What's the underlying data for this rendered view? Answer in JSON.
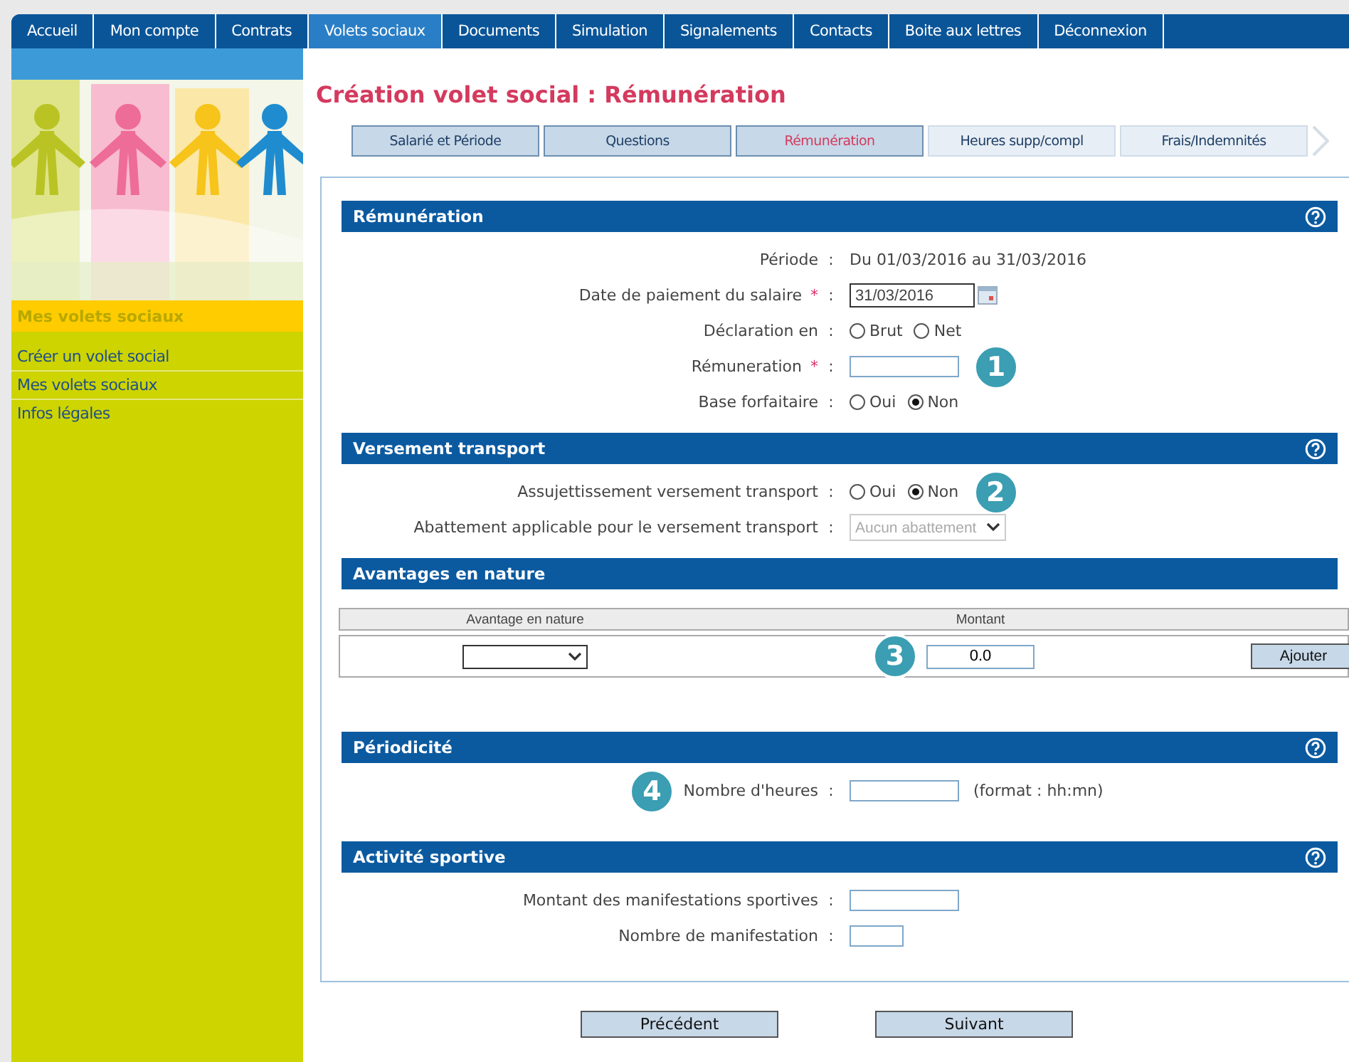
{
  "nav": [
    {
      "label": "Accueil",
      "selected": false
    },
    {
      "label": "Mon compte",
      "selected": false
    },
    {
      "label": "Contrats",
      "selected": false
    },
    {
      "label": "Volets sociaux",
      "selected": true
    },
    {
      "label": "Documents",
      "selected": false
    },
    {
      "label": "Simulation",
      "selected": false
    },
    {
      "label": "Signalements",
      "selected": false
    },
    {
      "label": "Contacts",
      "selected": false
    },
    {
      "label": "Boite aux lettres",
      "selected": false
    },
    {
      "label": "Déconnexion",
      "selected": false
    }
  ],
  "sidebar": {
    "heading": "Mes volets sociaux",
    "items": [
      "Créer un volet social",
      "Mes volets sociaux",
      "Infos légales"
    ]
  },
  "title": "Création volet social : Rémunération",
  "steps": [
    {
      "label": "Salarié et Période",
      "selected": false,
      "available": true
    },
    {
      "label": "Questions",
      "selected": false,
      "available": true
    },
    {
      "label": "Rémunération",
      "selected": true,
      "available": true
    },
    {
      "label": "Heures supp/compl",
      "selected": false,
      "available": false
    },
    {
      "label": "Frais/Indemnités",
      "selected": false,
      "available": false
    }
  ],
  "sections": [
    {
      "title": "Rémunération",
      "help": true,
      "kind": "form",
      "rows": [
        {
          "label": "Période",
          "separator": ":",
          "kind": "text",
          "value": "Du 01/03/2016 au 31/03/2016"
        },
        {
          "label": "Date de paiement du salaire",
          "marker": "*",
          "separator": ":",
          "kind": "date",
          "value": "31/03/2016"
        },
        {
          "label": "Déclaration en",
          "separator": ":",
          "kind": "radio",
          "options": [
            {
              "label": "Brut",
              "selected": false
            },
            {
              "label": "Net",
              "selected": false
            }
          ]
        },
        {
          "label": "Rémuneration",
          "marker": "*",
          "separator": ":",
          "kind": "input",
          "callout": "1"
        },
        {
          "label": "Base forfaitaire",
          "separator": ":",
          "kind": "radio",
          "options": [
            {
              "label": "Oui",
              "selected": false
            },
            {
              "label": "Non",
              "selected": true
            }
          ]
        }
      ]
    },
    {
      "title": "Versement transport",
      "help": true,
      "kind": "form",
      "rows": [
        {
          "label": "Assujettissement versement transport",
          "separator": ":",
          "kind": "radio",
          "options": [
            {
              "label": "Oui",
              "selected": false
            },
            {
              "label": "Non",
              "selected": true
            }
          ],
          "callout": "2"
        },
        {
          "label": "Abattement applicable pour le versement transport",
          "separator": ":",
          "kind": "select",
          "value": "Aucun abattement",
          "disabled": true
        }
      ]
    },
    {
      "title": "Avantages en nature",
      "help": false,
      "kind": "table",
      "columns": [
        "Avantage en nature",
        "Montant"
      ],
      "row": {
        "amount": "0.0",
        "button": "Ajouter",
        "callout": "3"
      }
    },
    {
      "title": "Périodicité",
      "help": true,
      "kind": "form",
      "rows": [
        {
          "label": "Nombre d'heures",
          "separator": ":",
          "kind": "input",
          "hint": "(format : hh:mn)",
          "callout_before": "4"
        }
      ]
    },
    {
      "title": "Activité sportive",
      "help": true,
      "kind": "form",
      "rows": [
        {
          "label": "Montant des manifestations sportives",
          "separator": ":",
          "kind": "input"
        },
        {
          "label": "Nombre de manifestation",
          "separator": ":",
          "kind": "short-input"
        }
      ]
    }
  ],
  "buttons": [
    "Précédent",
    "Suivant"
  ]
}
